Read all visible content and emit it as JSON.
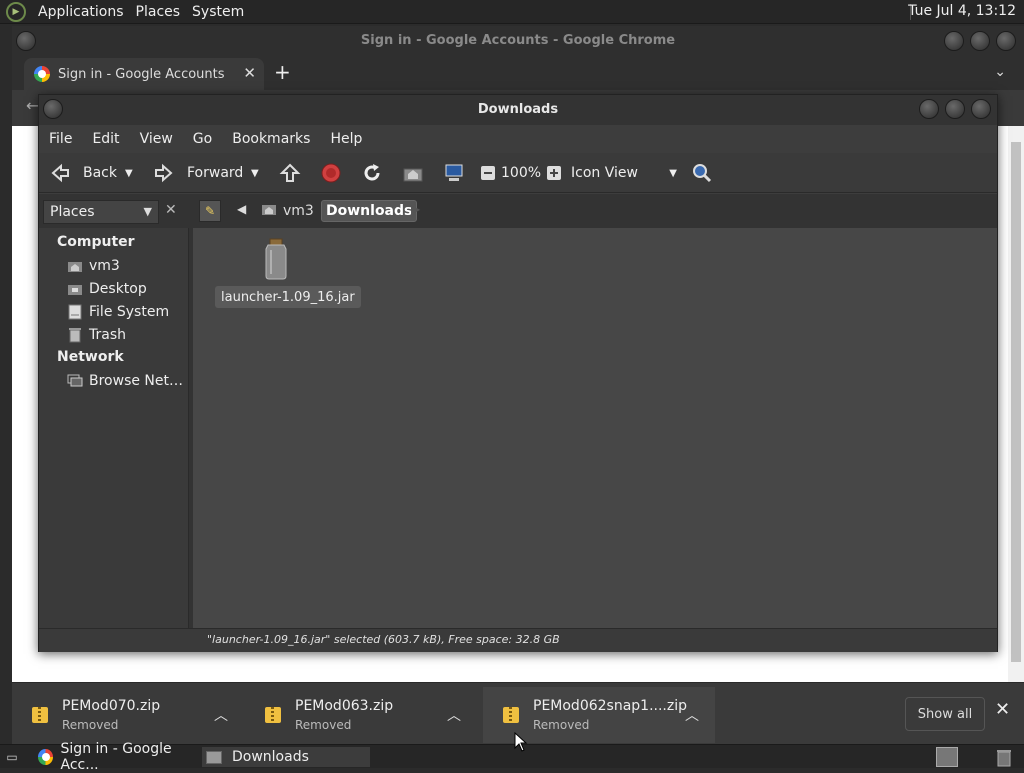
{
  "top_panel": {
    "menus": [
      "Applications",
      "Places",
      "System"
    ],
    "clock": "Tue Jul 4, 13:12"
  },
  "chrome": {
    "title": "Sign in - Google Accounts - Google Chrome",
    "tab_label": "Sign in - Google Accounts",
    "tab_close": "✕",
    "new_tab": "+",
    "tab_menu": "⌄"
  },
  "downloads_shelf": {
    "items": [
      {
        "name": "PEMod070.zip",
        "status": "Removed"
      },
      {
        "name": "PEMod063.zip",
        "status": "Removed"
      },
      {
        "name": "PEMod062snap1....zip",
        "status": "Removed"
      }
    ],
    "show_all": "Show all",
    "close": "✕"
  },
  "nautilus": {
    "title": "Downloads",
    "menu": [
      "File",
      "Edit",
      "View",
      "Go",
      "Bookmarks",
      "Help"
    ],
    "toolbar": {
      "back": "Back",
      "forward": "Forward",
      "zoom": "100%",
      "view_mode": "Icon View"
    },
    "location": {
      "places_combo": "Places",
      "crumbs": [
        "vm3",
        "Downloads"
      ]
    },
    "sidebar": {
      "computer_header": "Computer",
      "computer_items": [
        {
          "label": "vm3",
          "icon": "home-folder-icon"
        },
        {
          "label": "Desktop",
          "icon": "desktop-folder-icon"
        },
        {
          "label": "File System",
          "icon": "drive-icon"
        },
        {
          "label": "Trash",
          "icon": "trash-icon"
        }
      ],
      "network_header": "Network",
      "network_items": [
        {
          "label": "Browse Net…",
          "icon": "network-icon"
        }
      ]
    },
    "files": [
      {
        "name": "launcher-1.09_16.jar",
        "icon": "jar-icon",
        "selected": true
      }
    ],
    "status": "\"launcher-1.09_16.jar\" selected (603.7 kB), Free space: 32.8 GB"
  },
  "taskbar": {
    "tasks": [
      {
        "label": "Sign in - Google Acc...",
        "icon": "chrome-icon",
        "active": false
      },
      {
        "label": "Downloads",
        "icon": "folder-icon",
        "active": true
      }
    ]
  },
  "colors": {
    "panel": "#262626",
    "window": "#3d3d3d",
    "content": "#474747",
    "stop_red": "#d04040",
    "folder_yellow": "#f0c040"
  }
}
